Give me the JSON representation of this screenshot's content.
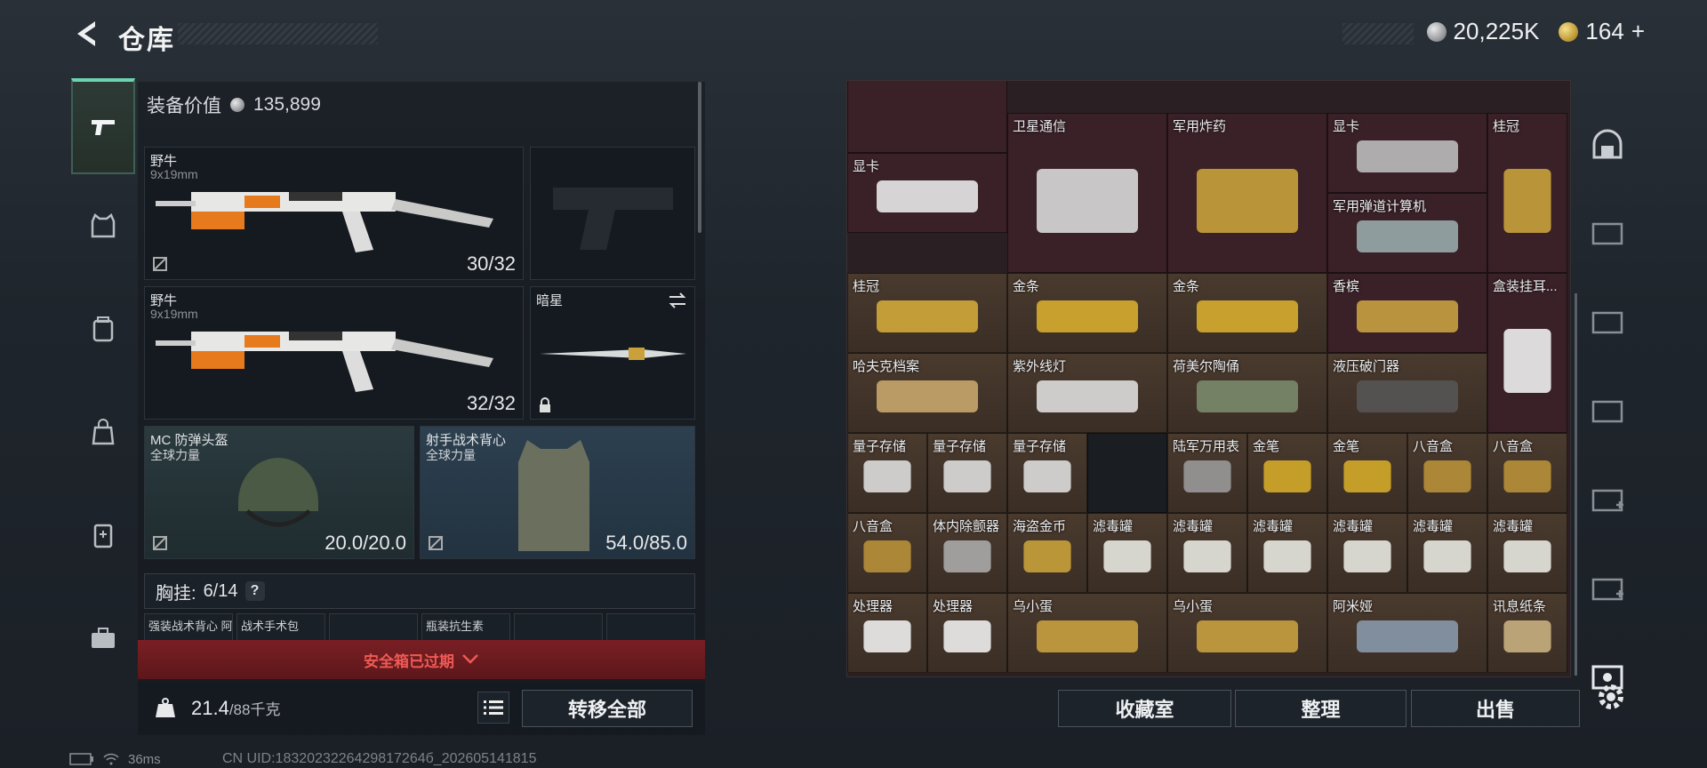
{
  "header": {
    "title": "仓库"
  },
  "currency": {
    "silver": "20,225K",
    "gold": "164",
    "gold_plus": "+"
  },
  "equip_value": {
    "label": "装备价值",
    "value": "135,899"
  },
  "slots": {
    "primary1": {
      "name": "野牛",
      "ammo": "9x19mm",
      "count": "30/32"
    },
    "primary2": {
      "name": "野牛",
      "ammo": "9x19mm",
      "count": "32/32"
    },
    "melee": {
      "name": "暗星"
    },
    "helmet": {
      "name": "MC 防弹头盔",
      "sub": "全球力量",
      "count": "20.0/20.0"
    },
    "armor": {
      "name": "射手战术背心",
      "sub": "全球力量",
      "count": "54.0/85.0"
    }
  },
  "chest": {
    "label": "胸挂:",
    "count": "6/14",
    "help": "?"
  },
  "pockets": [
    "强装战术背心 阿莉",
    "战术手术包",
    "",
    "瓶装抗生素",
    "",
    ""
  ],
  "safebox": {
    "label": "安全箱已过期"
  },
  "weight": {
    "value": "21.4",
    "unit": "/88千克"
  },
  "transfer_all": "转移全部",
  "grid_items": [
    {
      "label": "卫星通信"
    },
    {
      "label": "军用炸药"
    },
    {
      "label": "显卡"
    },
    {
      "label": "桂冠"
    },
    {
      "label": "显卡"
    },
    {
      "label": "军用弹道计算机"
    },
    {
      "label": "桂冠"
    },
    {
      "label": "金条"
    },
    {
      "label": "金条"
    },
    {
      "label": "香槟"
    },
    {
      "label": "盒装挂耳..."
    },
    {
      "label": "哈夫克档案"
    },
    {
      "label": "紫外线灯"
    },
    {
      "label": "荷美尔陶俑"
    },
    {
      "label": "液压破门器"
    },
    {
      "label": "量子存储"
    },
    {
      "label": "量子存储"
    },
    {
      "label": "量子存储"
    },
    {
      "label": "陆军万用表"
    },
    {
      "label": "金笔"
    },
    {
      "label": "金笔"
    },
    {
      "label": "八音盒"
    },
    {
      "label": "八音盒"
    },
    {
      "label": "八音盒"
    },
    {
      "label": "体内除颤器"
    },
    {
      "label": "海盗金币"
    },
    {
      "label": "滤毒罐"
    },
    {
      "label": "滤毒罐"
    },
    {
      "label": "滤毒罐"
    },
    {
      "label": "滤毒罐"
    },
    {
      "label": "滤毒罐"
    },
    {
      "label": "滤毒罐"
    },
    {
      "label": "处理器"
    },
    {
      "label": "处理器"
    },
    {
      "label": "乌小蛋"
    },
    {
      "label": "乌小蛋"
    },
    {
      "label": "阿米娅"
    },
    {
      "label": "讯息纸条"
    }
  ],
  "buttons": {
    "collect": "收藏室",
    "sort": "整理",
    "sell": "出售"
  },
  "status": {
    "ping": "36ms",
    "uid": "CN UID:1832023226429817264б_202605141815"
  }
}
